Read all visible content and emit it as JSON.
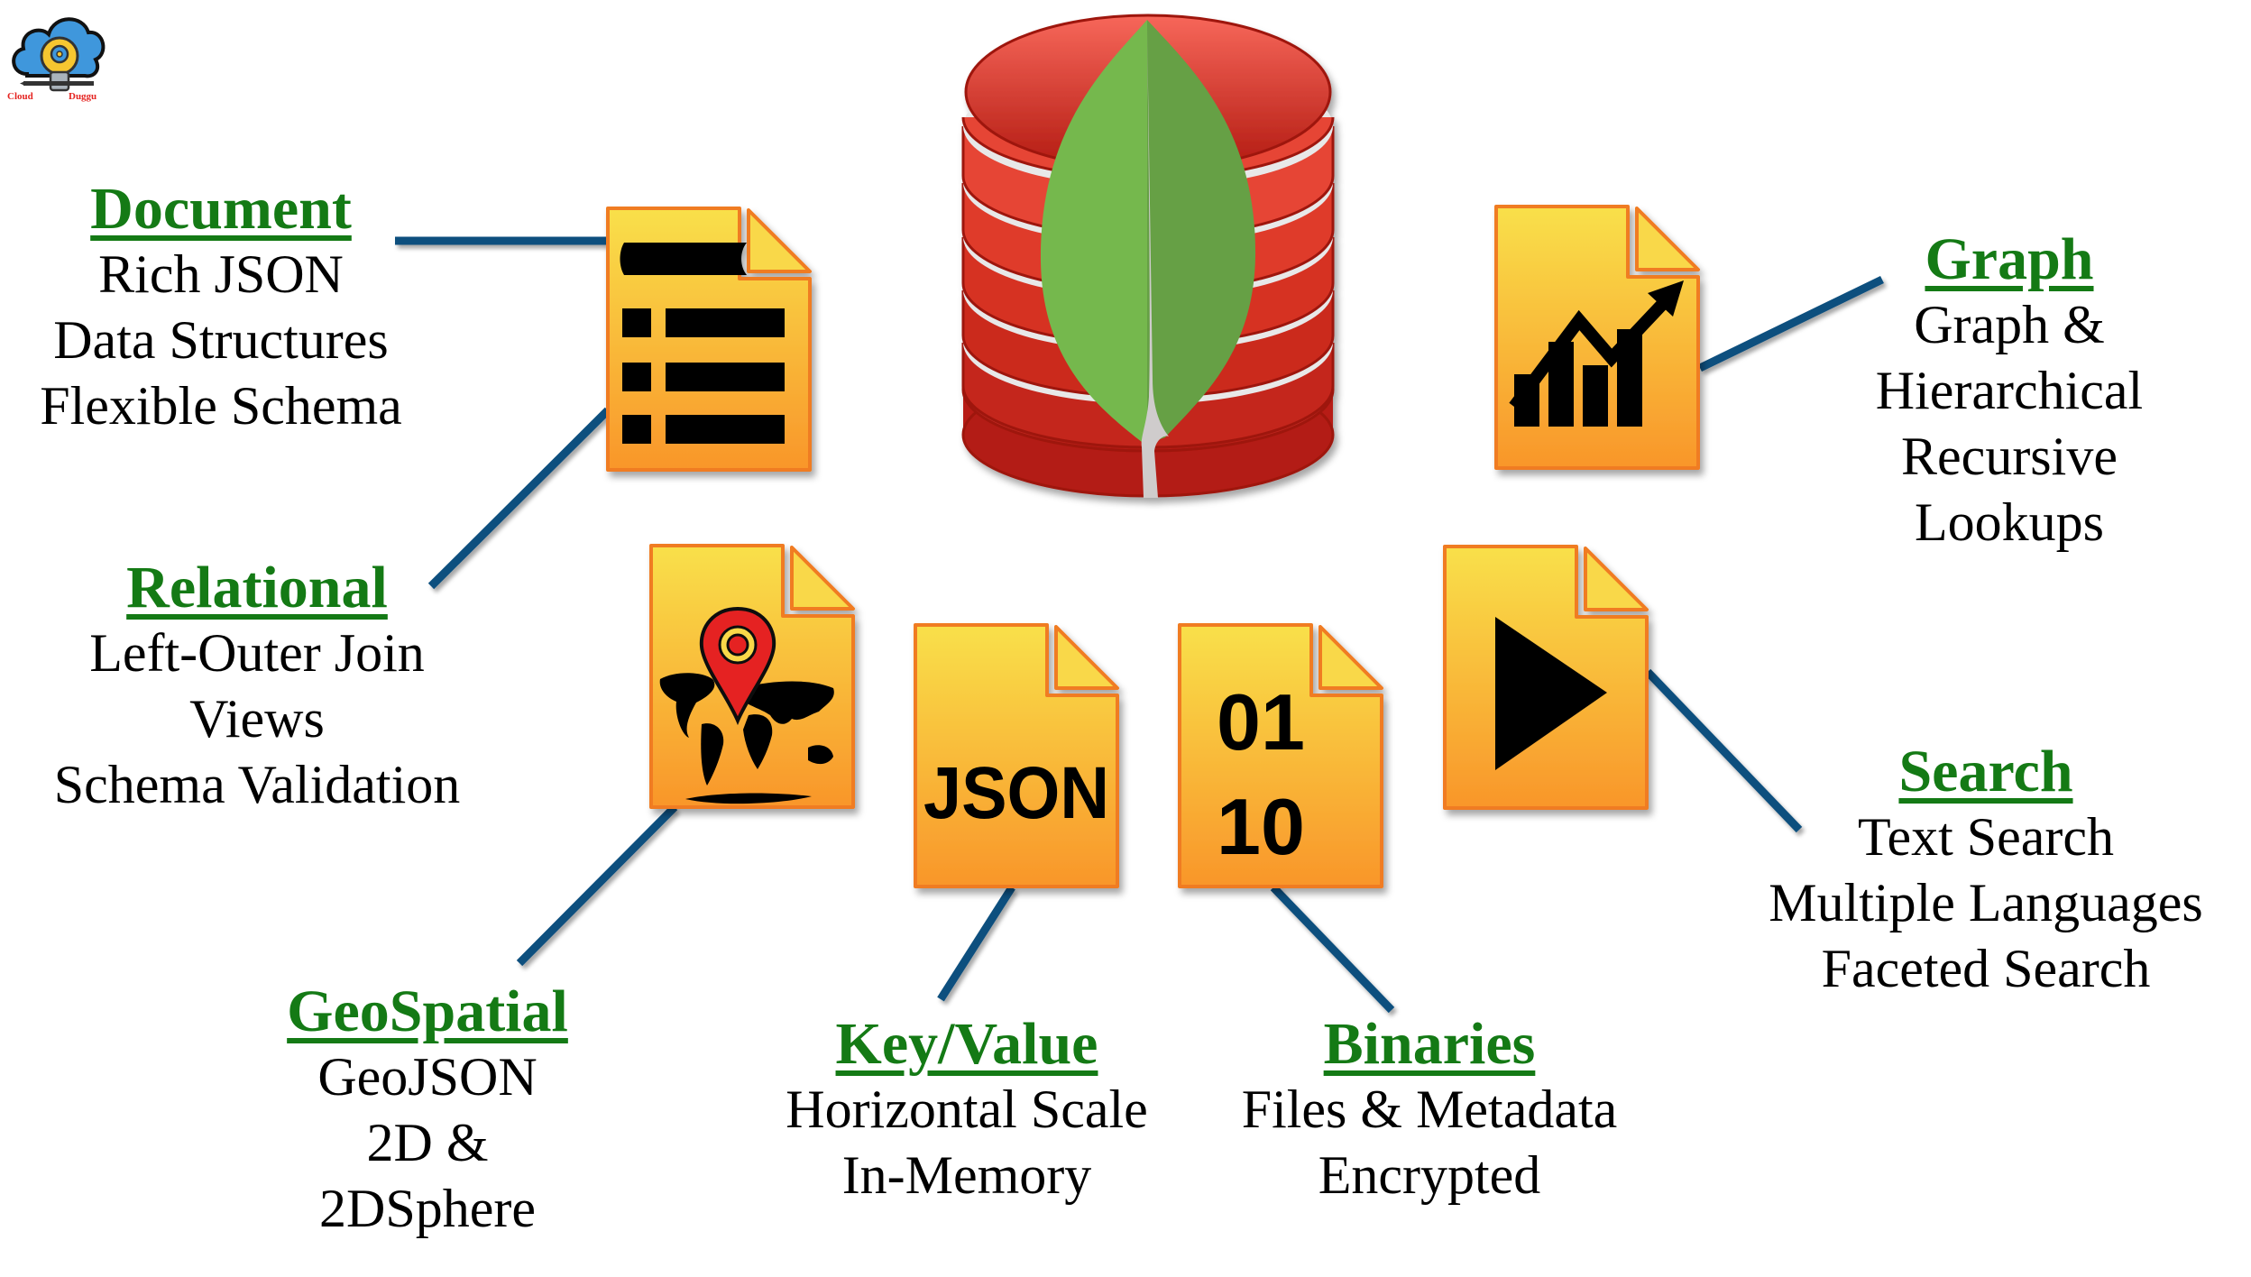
{
  "logo": {
    "left_text": "Cloud",
    "right_text": "Duggu",
    "icon": "cloud-lightbulb-icon"
  },
  "center": {
    "icon": "mongodb-database-leaf-icon"
  },
  "colors": {
    "title_green": "#147a15",
    "connector_blue": "#0e4f7e",
    "icon_fill_top": "#f9e04a",
    "icon_fill_bottom": "#f9962a",
    "icon_border": "#f07b22",
    "db_red_top": "#f7675a",
    "db_red_bottom": "#b31b12",
    "leaf_light": "#74b84e",
    "leaf_dark": "#66a044",
    "stem": "#cfcccc"
  },
  "features": {
    "document": {
      "title": "Document",
      "lines": [
        "Rich JSON",
        "Data Structures",
        "Flexible Schema"
      ],
      "icon": "document-list-icon"
    },
    "relational": {
      "title": "Relational",
      "lines": [
        "Left-Outer Join",
        "Views",
        "Schema Validation"
      ],
      "icon": "document-list-icon"
    },
    "geospatial": {
      "title": "GeoSpatial",
      "lines": [
        "GeoJSON",
        "2D &",
        "2DSphere"
      ],
      "icon": "world-map-pin-icon"
    },
    "keyvalue": {
      "title": "Key/Value",
      "lines": [
        "Horizontal Scale",
        "In-Memory"
      ],
      "icon": "json-file-icon",
      "icon_text": "JSON"
    },
    "binaries": {
      "title": "Binaries",
      "lines": [
        "Files & Metadata",
        "Encrypted"
      ],
      "icon": "binary-file-icon",
      "icon_text_1": "01",
      "icon_text_2": "10"
    },
    "search": {
      "title": "Search",
      "lines": [
        "Text Search",
        "Multiple Languages",
        "Faceted Search"
      ],
      "icon": "play-file-icon"
    },
    "graph": {
      "title": "Graph",
      "lines": [
        "Graph &",
        "Hierarchical",
        "Recursive",
        "Lookups"
      ],
      "icon": "chart-file-icon"
    }
  }
}
